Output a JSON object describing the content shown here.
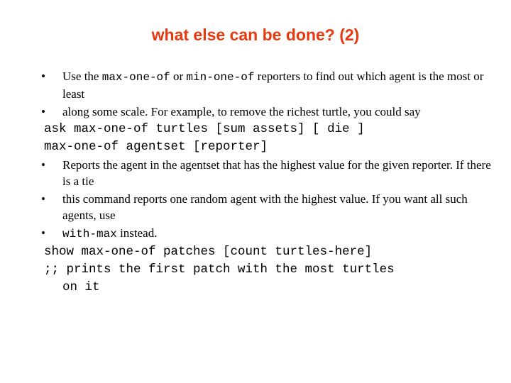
{
  "slide": {
    "title": "what else can be done? (2)",
    "bullet_glyph": "•",
    "b1": {
      "pre": "Use the ",
      "code1": "max-one-of",
      "mid": " or ",
      "code2": "min-one-of",
      "post": " reporters to find out which agent is the most or least"
    },
    "b2": "along some scale. For example, to remove the richest turtle, you could say",
    "code1": "ask max-one-of turtles [sum assets] [ die ]",
    "code2": "max-one-of agentset [reporter]",
    "b3": "Reports the agent in the agentset that has the highest value for the given reporter. If there is a tie",
    "b4": "this command reports one random agent with the highest value. If you want all such agents, use",
    "b5": {
      "code": "with-max",
      "post": " instead."
    },
    "code3": "show max-one-of patches [count turtles-here]",
    "code4": ";; prints the first patch with the most turtles",
    "code4_cont": "on it"
  }
}
